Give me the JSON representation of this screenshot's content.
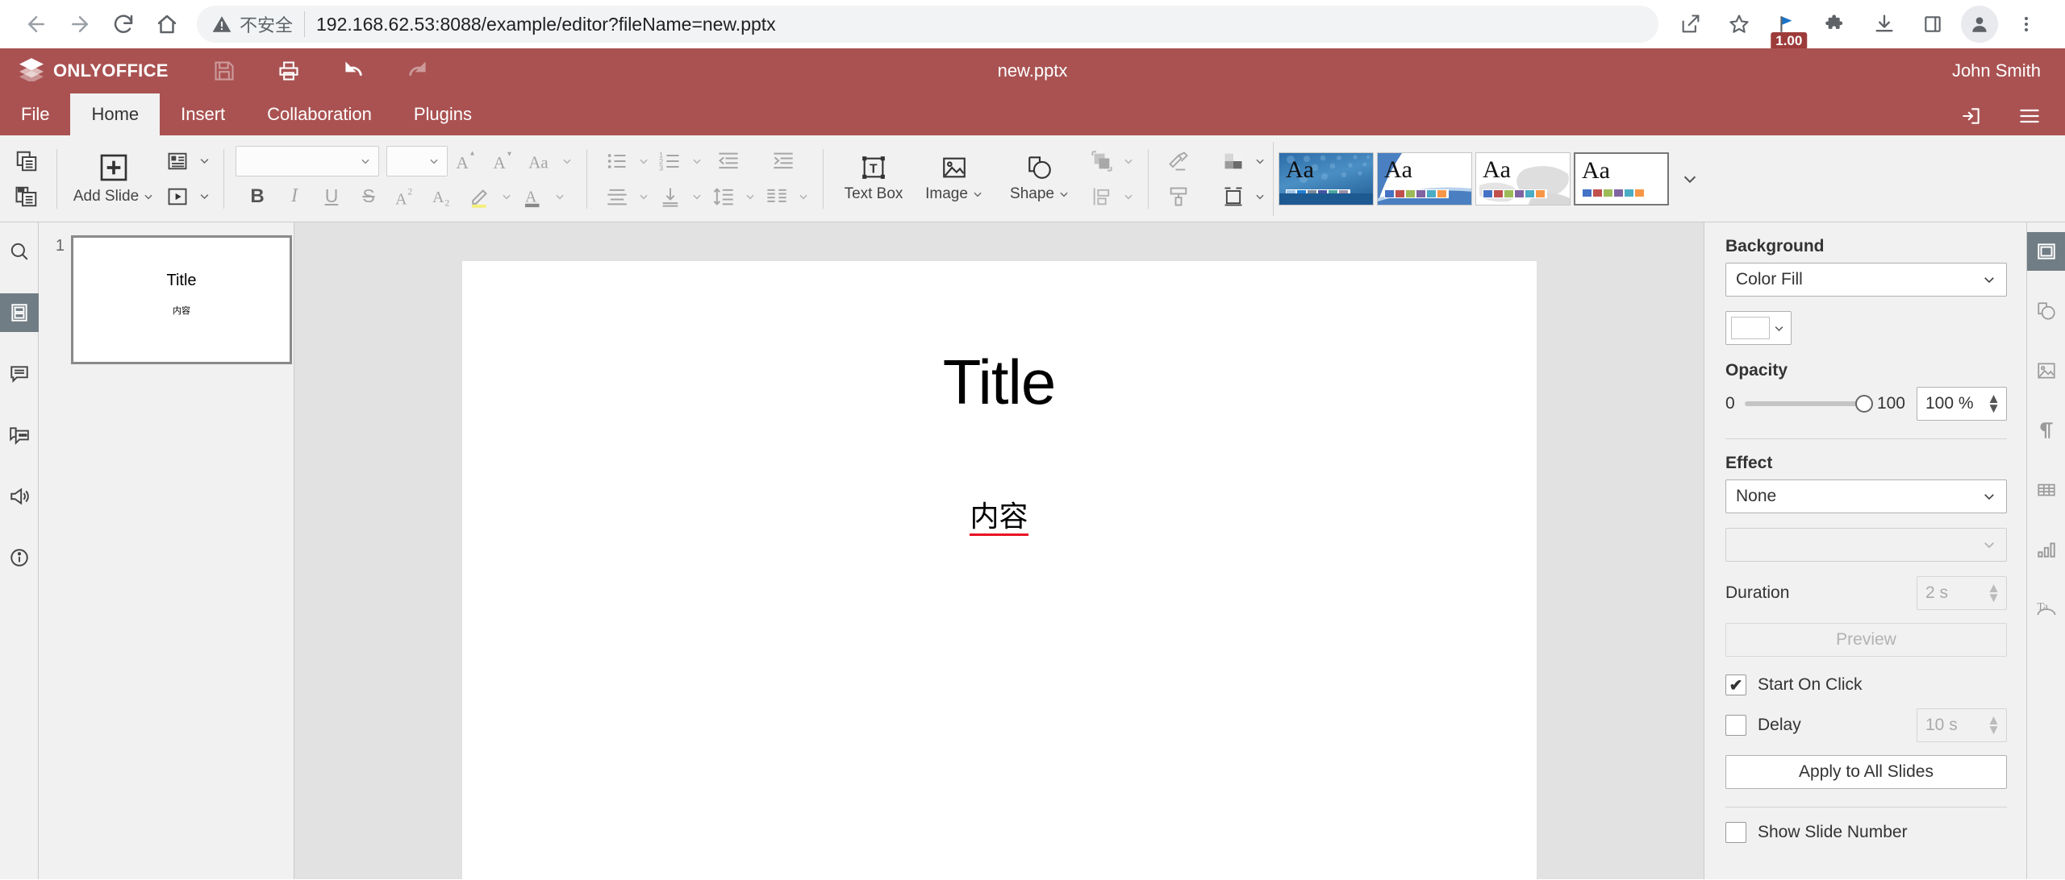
{
  "browser": {
    "back_icon": "arrow-left-icon",
    "forward_icon": "arrow-right-icon",
    "reload_icon": "reload-icon",
    "home_icon": "home-icon",
    "security_label": "不安全",
    "url_host": "192.168.62.53",
    "url_port": ":8088",
    "url_path": "/example/editor?fileName=new.pptx",
    "url_full": "192.168.62.53:8088/example/editor?fileName=new.pptx",
    "icons": [
      {
        "name": "share-icon",
        "label": "Share"
      },
      {
        "name": "bookmark-star-icon",
        "label": "Bookmark"
      },
      {
        "name": "flag-extension-icon",
        "label": "Extension",
        "badge": "1.00"
      },
      {
        "name": "puzzle-extensions-icon",
        "label": "Extensions"
      },
      {
        "name": "download-icon",
        "label": "Downloads"
      },
      {
        "name": "sidepanel-icon",
        "label": "Side panel"
      },
      {
        "name": "profile-avatar-icon",
        "label": "Profile"
      },
      {
        "name": "three-dot-menu-icon",
        "label": "Customize and control"
      }
    ]
  },
  "header": {
    "brand": "ONLYOFFICE",
    "document_title": "new.pptx",
    "user_name": "John Smith",
    "accent_color": "#aa5252",
    "quick_access": [
      {
        "name": "save-button",
        "label": "Save",
        "disabled": true
      },
      {
        "name": "print-button",
        "label": "Print",
        "disabled": false
      },
      {
        "name": "undo-button",
        "label": "Undo",
        "disabled": false
      },
      {
        "name": "redo-button",
        "label": "Redo",
        "disabled": true
      }
    ],
    "right_buttons": [
      {
        "name": "open-file-location-button",
        "label": "Open file location"
      },
      {
        "name": "view-settings-button",
        "label": "View settings"
      }
    ]
  },
  "tabs": [
    {
      "label": "File",
      "active": false
    },
    {
      "label": "Home",
      "active": true
    },
    {
      "label": "Insert",
      "active": false
    },
    {
      "label": "Collaboration",
      "active": false
    },
    {
      "label": "Plugins",
      "active": false
    }
  ],
  "ribbon": {
    "copy_label": "Copy",
    "paste_label": "Paste",
    "add_slide_label": "Add Slide",
    "change_layout_label": "Change slide layout",
    "start_slideshow_label": "Start slideshow",
    "font_name_value": "",
    "font_name_placeholder": "",
    "font_size_value": "",
    "font_size_placeholder": "",
    "increase_font_label": "Increase font size",
    "decrease_font_label": "Decrease font size",
    "change_case_label": "Change case",
    "bold_label": "B",
    "italic_label": "I",
    "underline_label": "U",
    "strike_label": "S",
    "superscript_label": "A",
    "subscript_label": "A",
    "highlight_label": "Highlight color",
    "font_color_label": "Font color",
    "bullets_label": "Bullets",
    "numbering_label": "Numbering",
    "decrease_indent_label": "Decrease indent",
    "increase_indent_label": "Increase indent",
    "align_label": "Horizontal align",
    "valign_label": "Vertical align",
    "line_spacing_label": "Line spacing",
    "columns_label": "Columns",
    "text_box_label": "Text Box",
    "image_label": "Image",
    "shape_label": "Shape",
    "arrange_label": "Arrange shape",
    "align_shape_label": "Align shape",
    "clear_style_label": "Clear style",
    "color_scheme_label": "Color scheme",
    "paint_format_label": "Copy style",
    "slide_size_label": "Slide size",
    "themes": [
      {
        "name": "theme-dots-blue",
        "aa": "Aa",
        "selected": false,
        "swatches": [
          "#9dc3e6",
          "#1f7fd4",
          "#7a8a99",
          "#4455a3",
          "#4aa5a0",
          "#9b8fa8"
        ]
      },
      {
        "name": "theme-wave-blue",
        "aa": "Aa",
        "selected": false,
        "swatches": [
          "#4472c4",
          "#c0504d",
          "#9bbb59",
          "#8064a2",
          "#4bacc6",
          "#f79646"
        ]
      },
      {
        "name": "theme-gray-rock",
        "aa": "Aa",
        "selected": false,
        "swatches": [
          "#4472c4",
          "#c0504d",
          "#9bbb59",
          "#8064a2",
          "#4bacc6",
          "#f79646"
        ]
      },
      {
        "name": "theme-blank",
        "aa": "Aa",
        "selected": true,
        "swatches": [
          "#4472c4",
          "#c0504d",
          "#9bbb59",
          "#8064a2",
          "#4bacc6",
          "#f79646"
        ]
      }
    ],
    "more_themes_label": "More themes"
  },
  "left_rail": [
    {
      "name": "sidebar-item-search",
      "icon": "search-icon",
      "label": "Search",
      "active": false
    },
    {
      "name": "sidebar-item-slides",
      "icon": "slides-icon",
      "label": "Slides",
      "active": true
    },
    {
      "name": "sidebar-item-comments",
      "icon": "comment-icon",
      "label": "Comments",
      "active": false
    },
    {
      "name": "sidebar-item-chat",
      "icon": "chat-icon",
      "label": "Chat",
      "active": false
    },
    {
      "name": "sidebar-item-feedback",
      "icon": "megaphone-icon",
      "label": "Feedback & Support",
      "active": false
    },
    {
      "name": "sidebar-item-about",
      "icon": "info-icon",
      "label": "About",
      "active": false
    }
  ],
  "slides": [
    {
      "number": "1",
      "title": "Title",
      "body": "内容"
    }
  ],
  "canvas": {
    "title": "Title",
    "body": "内容",
    "body_spellcheck_error": true
  },
  "right_panel": {
    "background_label": "Background",
    "background_fill_value": "Color Fill",
    "background_color_hex": "#ffffff",
    "opacity_label": "Opacity",
    "opacity_min": "0",
    "opacity_max": "100",
    "opacity_value": "100 %",
    "effect_label": "Effect",
    "effect_value": "None",
    "effect_variant_value": "",
    "duration_label": "Duration",
    "duration_value": "2 s",
    "preview_label": "Preview",
    "start_on_click_label": "Start On Click",
    "start_on_click_checked": true,
    "delay_label": "Delay",
    "delay_checked": false,
    "delay_value": "10 s",
    "apply_all_label": "Apply to All Slides",
    "show_slide_number_label": "Show Slide Number",
    "show_slide_number_checked": false
  },
  "right_rail": [
    {
      "name": "panel-item-slide-settings",
      "icon": "slide-settings-icon",
      "label": "Slide settings",
      "active": true
    },
    {
      "name": "panel-item-shape-settings",
      "icon": "shape-icon",
      "label": "Shape settings",
      "active": false
    },
    {
      "name": "panel-item-image-settings",
      "icon": "image-icon",
      "label": "Image settings",
      "active": false
    },
    {
      "name": "panel-item-paragraph-settings",
      "icon": "paragraph-icon",
      "label": "Paragraph settings",
      "active": false
    },
    {
      "name": "panel-item-table-settings",
      "icon": "table-icon",
      "label": "Table settings",
      "active": false
    },
    {
      "name": "panel-item-chart-settings",
      "icon": "chart-icon",
      "label": "Chart settings",
      "active": false
    },
    {
      "name": "panel-item-textart-settings",
      "icon": "text-art-icon",
      "label": "Text Art settings",
      "active": false
    }
  ]
}
